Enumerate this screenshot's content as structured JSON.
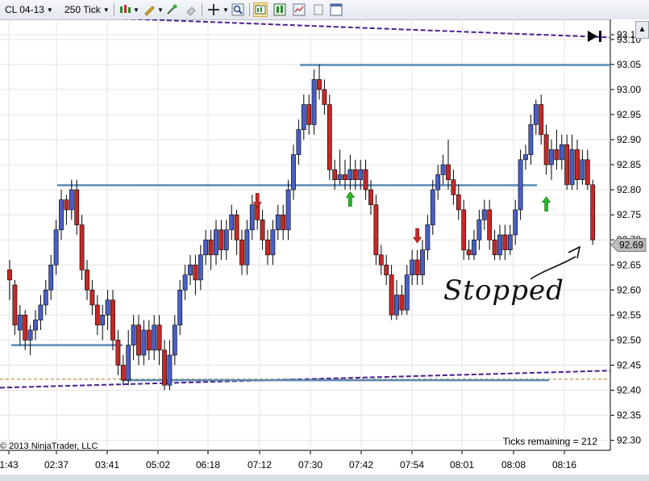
{
  "toolbar": {
    "instrument": "CL 04-13",
    "period": "250 Tick"
  },
  "colors": {
    "up": "#4a5fc4",
    "down": "#c62828",
    "hline": "#5b8bb5",
    "channel": "#4b1f8f",
    "gold": "#c89a4e",
    "arrow_up": "#22bb22",
    "arrow_down": "#c62828"
  },
  "chart_data": {
    "type": "candlestick",
    "y_ticks": [
      "93.1",
      "93.10",
      "93.05",
      "93.00",
      "92.95",
      "92.90",
      "92.85",
      "92.80",
      "92.75",
      "92.70",
      "92.65",
      "92.60",
      "92.55",
      "92.50",
      "92.45",
      "92.40",
      "92.35",
      "92.30"
    ],
    "ylim": [
      92.28,
      93.14
    ],
    "x_ticks": [
      "1:43",
      "02:37",
      "03:41",
      "05:02",
      "06:18",
      "07:12",
      "07:30",
      "07:42",
      "07:54",
      "08:01",
      "08:08",
      "08:16"
    ],
    "last_price": "92.69",
    "candles": [
      [
        92.64,
        92.62,
        92.66,
        92.58
      ],
      [
        92.61,
        92.53,
        92.62,
        92.51
      ],
      [
        92.52,
        92.55,
        92.57,
        92.49
      ],
      [
        92.55,
        92.5,
        92.56,
        92.48
      ],
      [
        92.5,
        92.52,
        92.53,
        92.47
      ],
      [
        92.52,
        92.54,
        92.56,
        92.5
      ],
      [
        92.54,
        92.57,
        92.59,
        92.52
      ],
      [
        92.57,
        92.6,
        92.62,
        92.55
      ],
      [
        92.6,
        92.65,
        92.67,
        92.58
      ],
      [
        92.65,
        92.72,
        92.74,
        92.63
      ],
      [
        92.72,
        92.78,
        92.8,
        92.7
      ],
      [
        92.78,
        92.76,
        92.79,
        92.73
      ],
      [
        92.76,
        92.8,
        92.82,
        92.74
      ],
      [
        92.8,
        92.73,
        92.82,
        92.71
      ],
      [
        92.73,
        92.64,
        92.75,
        92.62
      ],
      [
        92.64,
        92.6,
        92.66,
        92.58
      ],
      [
        92.6,
        92.57,
        92.62,
        92.55
      ],
      [
        92.57,
        92.53,
        92.59,
        92.51
      ],
      [
        92.53,
        92.55,
        92.57,
        92.5
      ],
      [
        92.55,
        92.58,
        92.6,
        92.52
      ],
      [
        92.58,
        92.5,
        92.6,
        92.48
      ],
      [
        92.5,
        92.45,
        92.52,
        92.43
      ],
      [
        92.45,
        92.42,
        92.47,
        92.41
      ],
      [
        92.42,
        92.49,
        92.52,
        92.41
      ],
      [
        92.49,
        92.53,
        92.55,
        92.46
      ],
      [
        92.53,
        92.47,
        92.55,
        92.45
      ],
      [
        92.47,
        92.52,
        92.54,
        92.45
      ],
      [
        92.52,
        92.48,
        92.54,
        92.46
      ],
      [
        92.48,
        92.53,
        92.55,
        92.46
      ],
      [
        92.53,
        92.48,
        92.55,
        92.45
      ],
      [
        92.48,
        92.41,
        92.5,
        92.4
      ],
      [
        92.41,
        92.47,
        92.5,
        92.4
      ],
      [
        92.47,
        92.53,
        92.55,
        92.45
      ],
      [
        92.53,
        92.6,
        92.62,
        92.51
      ],
      [
        92.6,
        92.63,
        92.65,
        92.58
      ],
      [
        92.63,
        92.65,
        92.67,
        92.61
      ],
      [
        92.65,
        92.62,
        92.67,
        92.59
      ],
      [
        92.62,
        92.67,
        92.69,
        92.6
      ],
      [
        92.67,
        92.7,
        92.72,
        92.65
      ],
      [
        92.7,
        92.67,
        92.72,
        92.64
      ],
      [
        92.67,
        92.72,
        92.74,
        92.65
      ],
      [
        92.72,
        92.68,
        92.74,
        92.66
      ],
      [
        92.68,
        92.72,
        92.74,
        92.66
      ],
      [
        92.72,
        92.75,
        92.77,
        92.7
      ],
      [
        92.75,
        92.7,
        92.76,
        92.67
      ],
      [
        92.7,
        92.65,
        92.72,
        92.63
      ],
      [
        92.65,
        92.72,
        92.74,
        92.63
      ],
      [
        92.72,
        92.77,
        92.79,
        92.7
      ],
      [
        92.77,
        92.74,
        92.79,
        92.72
      ],
      [
        92.74,
        92.7,
        92.76,
        92.68
      ],
      [
        92.7,
        92.67,
        92.72,
        92.65
      ],
      [
        92.67,
        92.72,
        92.74,
        92.65
      ],
      [
        92.72,
        92.75,
        92.77,
        92.7
      ],
      [
        92.75,
        92.72,
        92.77,
        92.7
      ],
      [
        92.72,
        92.8,
        92.82,
        92.7
      ],
      [
        92.8,
        92.87,
        92.89,
        92.78
      ],
      [
        92.87,
        92.92,
        92.94,
        92.85
      ],
      [
        92.92,
        92.97,
        92.99,
        92.9
      ],
      [
        92.97,
        92.93,
        92.99,
        92.91
      ],
      [
        92.93,
        93.02,
        93.04,
        92.91
      ],
      [
        93.02,
        93.0,
        93.05,
        92.98
      ],
      [
        93.0,
        92.97,
        93.02,
        92.95
      ],
      [
        92.97,
        92.84,
        92.99,
        92.82
      ],
      [
        92.84,
        92.82,
        92.86,
        92.8
      ],
      [
        92.82,
        92.83,
        92.88,
        92.81
      ],
      [
        92.83,
        92.82,
        92.86,
        92.8
      ],
      [
        92.82,
        92.84,
        92.87,
        92.8
      ],
      [
        92.84,
        92.82,
        92.86,
        92.8
      ],
      [
        92.82,
        92.84,
        92.86,
        92.8
      ],
      [
        92.84,
        92.8,
        92.86,
        92.78
      ],
      [
        92.8,
        92.77,
        92.82,
        92.75
      ],
      [
        92.77,
        92.67,
        92.79,
        92.65
      ],
      [
        92.67,
        92.65,
        92.69,
        92.63
      ],
      [
        92.65,
        92.63,
        92.67,
        92.61
      ],
      [
        92.63,
        92.55,
        92.65,
        92.54
      ],
      [
        92.55,
        92.59,
        92.62,
        92.54
      ],
      [
        92.59,
        92.56,
        92.61,
        92.55
      ],
      [
        92.56,
        92.63,
        92.65,
        92.55
      ],
      [
        92.63,
        92.66,
        92.68,
        92.61
      ],
      [
        92.66,
        92.63,
        92.68,
        92.61
      ],
      [
        92.63,
        92.68,
        92.7,
        92.61
      ],
      [
        92.68,
        92.73,
        92.75,
        92.66
      ],
      [
        92.73,
        92.8,
        92.82,
        92.71
      ],
      [
        92.8,
        92.83,
        92.85,
        92.78
      ],
      [
        92.83,
        92.85,
        92.87,
        92.81
      ],
      [
        92.85,
        92.82,
        92.9,
        92.8
      ],
      [
        92.82,
        92.79,
        92.84,
        92.77
      ],
      [
        92.79,
        92.76,
        92.81,
        92.74
      ],
      [
        92.76,
        92.68,
        92.78,
        92.66
      ],
      [
        92.68,
        92.67,
        92.7,
        92.66
      ],
      [
        92.67,
        92.7,
        92.72,
        92.66
      ],
      [
        92.7,
        92.74,
        92.76,
        92.68
      ],
      [
        92.74,
        92.76,
        92.78,
        92.72
      ],
      [
        92.76,
        92.7,
        92.78,
        92.68
      ],
      [
        92.7,
        92.67,
        92.72,
        92.66
      ],
      [
        92.67,
        92.71,
        92.73,
        92.66
      ],
      [
        92.71,
        92.68,
        92.73,
        92.66
      ],
      [
        92.68,
        92.71,
        92.73,
        92.67
      ],
      [
        92.71,
        92.76,
        92.78,
        92.69
      ],
      [
        92.76,
        92.86,
        92.88,
        92.74
      ],
      [
        92.86,
        92.87,
        92.89,
        92.84
      ],
      [
        92.87,
        92.93,
        92.95,
        92.85
      ],
      [
        92.93,
        92.97,
        92.98,
        92.91
      ],
      [
        92.97,
        92.91,
        92.99,
        92.89
      ],
      [
        92.91,
        92.85,
        92.93,
        92.83
      ],
      [
        92.85,
        92.88,
        92.9,
        92.82
      ],
      [
        92.88,
        92.86,
        92.92,
        92.84
      ],
      [
        92.86,
        92.89,
        92.91,
        92.84
      ],
      [
        92.89,
        92.81,
        92.91,
        92.8
      ],
      [
        92.81,
        92.88,
        92.91,
        92.8
      ],
      [
        92.88,
        92.82,
        92.9,
        92.8
      ],
      [
        92.82,
        92.86,
        92.88,
        92.81
      ],
      [
        92.86,
        92.81,
        92.88,
        92.8
      ],
      [
        92.81,
        92.7,
        92.82,
        92.69
      ]
    ],
    "hlines": [
      {
        "y": 93.049,
        "x0": 372,
        "x1": 757
      },
      {
        "y": 92.809,
        "x0": 71,
        "x1": 666
      },
      {
        "y": 92.49,
        "x0": 14,
        "x1": 152
      },
      {
        "y": 92.42,
        "x0": 152,
        "x1": 681
      }
    ],
    "channel_lines": [
      {
        "y0": 93.151,
        "y1": 93.104
      },
      {
        "y0": 92.405,
        "y1": 92.439
      }
    ],
    "gold_line": 92.422,
    "signals": [
      {
        "type": "down",
        "bar": 48,
        "price": 92.78
      },
      {
        "type": "up",
        "bar": 66,
        "price": 92.78
      },
      {
        "type": "down",
        "bar": 79,
        "price": 92.71
      },
      {
        "type": "up",
        "bar": 104,
        "price": 92.77
      }
    ]
  },
  "annotations": {
    "stopped": "Stopped",
    "copyright": "© 2013 NinjaTrader, LLC",
    "ticks_remaining": "Ticks remaining = 212"
  }
}
